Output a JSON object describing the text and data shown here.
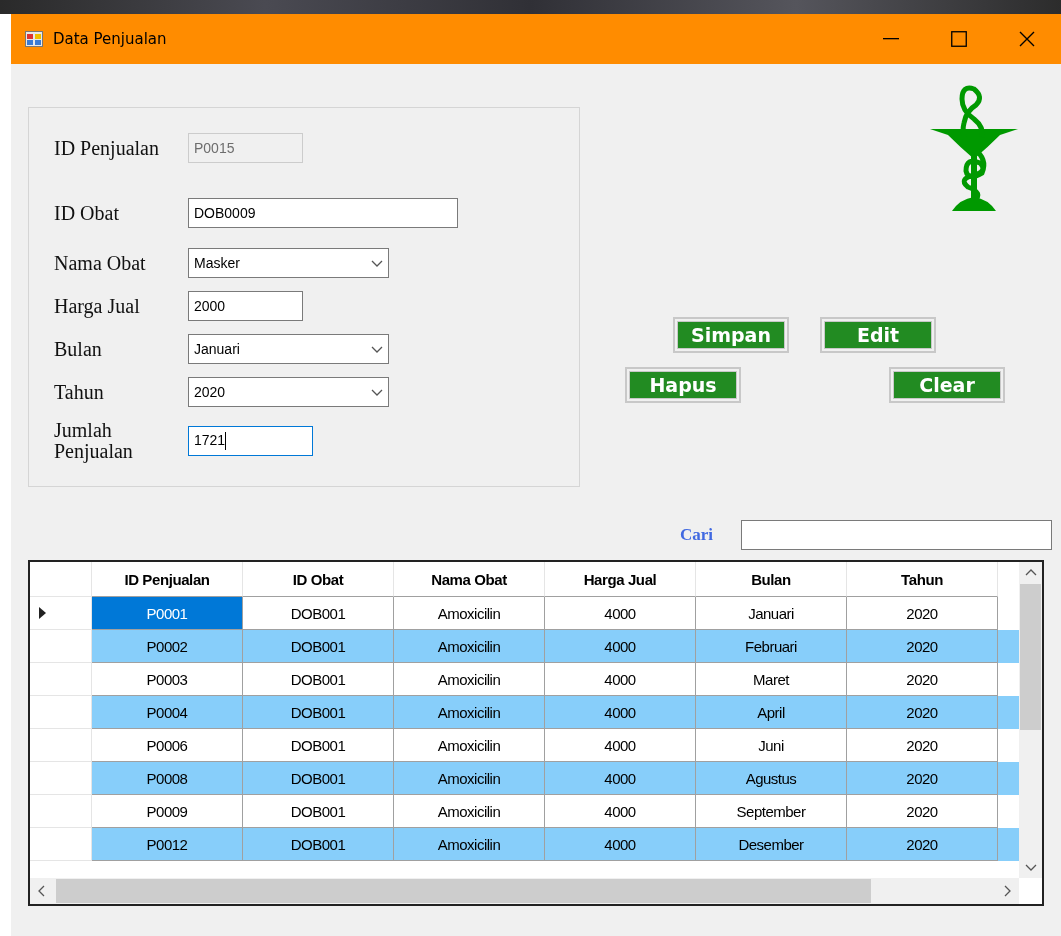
{
  "window": {
    "title": "Data Penjualan"
  },
  "form": {
    "fields": [
      {
        "label": "ID Penjualan",
        "kind": "text",
        "value": "P0015",
        "disabled": true,
        "focused": false
      },
      {
        "label": "ID Obat",
        "kind": "text",
        "value": "DOB0009",
        "disabled": false,
        "focused": false
      },
      {
        "label": "Nama Obat",
        "kind": "combo",
        "value": "Masker",
        "disabled": false,
        "focused": false
      },
      {
        "label": "Harga Jual",
        "kind": "text",
        "value": "2000",
        "disabled": false,
        "focused": false
      },
      {
        "label": "Bulan",
        "kind": "combo",
        "value": "Januari",
        "disabled": false,
        "focused": false
      },
      {
        "label": "Tahun",
        "kind": "combo",
        "value": "2020",
        "disabled": false,
        "focused": false
      },
      {
        "label": "Jumlah Penjualan",
        "kind": "text",
        "value": "1721",
        "disabled": false,
        "focused": true
      }
    ]
  },
  "buttons": [
    "Simpan",
    "Edit",
    "Hapus",
    "Clear"
  ],
  "search": {
    "label": "Cari"
  },
  "table": {
    "columns": [
      "ID Penjualan",
      "ID Obat",
      "Nama Obat",
      "Harga Jual",
      "Bulan",
      "Tahun"
    ],
    "rows": [
      {
        "current": true,
        "cells": [
          {
            "text": "P0001",
            "selected": true
          },
          {
            "text": "DOB001",
            "selected": false
          },
          {
            "text": "Amoxicilin",
            "selected": false
          },
          {
            "text": "4000",
            "selected": false
          },
          {
            "text": "Januari",
            "selected": false
          },
          {
            "text": "2020",
            "selected": false
          }
        ]
      },
      {
        "current": false,
        "cells": [
          {
            "text": "P0002",
            "selected": false
          },
          {
            "text": "DOB001",
            "selected": false
          },
          {
            "text": "Amoxicilin",
            "selected": false
          },
          {
            "text": "4000",
            "selected": false
          },
          {
            "text": "Februari",
            "selected": false
          },
          {
            "text": "2020",
            "selected": false
          }
        ]
      },
      {
        "current": false,
        "cells": [
          {
            "text": "P0003",
            "selected": false
          },
          {
            "text": "DOB001",
            "selected": false
          },
          {
            "text": "Amoxicilin",
            "selected": false
          },
          {
            "text": "4000",
            "selected": false
          },
          {
            "text": "Maret",
            "selected": false
          },
          {
            "text": "2020",
            "selected": false
          }
        ]
      },
      {
        "current": false,
        "cells": [
          {
            "text": "P0004",
            "selected": false
          },
          {
            "text": "DOB001",
            "selected": false
          },
          {
            "text": "Amoxicilin",
            "selected": false
          },
          {
            "text": "4000",
            "selected": false
          },
          {
            "text": "April",
            "selected": false
          },
          {
            "text": "2020",
            "selected": false
          }
        ]
      },
      {
        "current": false,
        "cells": [
          {
            "text": "P0006",
            "selected": false
          },
          {
            "text": "DOB001",
            "selected": false
          },
          {
            "text": "Amoxicilin",
            "selected": false
          },
          {
            "text": "4000",
            "selected": false
          },
          {
            "text": "Juni",
            "selected": false
          },
          {
            "text": "2020",
            "selected": false
          }
        ]
      },
      {
        "current": false,
        "cells": [
          {
            "text": "P0008",
            "selected": false
          },
          {
            "text": "DOB001",
            "selected": false
          },
          {
            "text": "Amoxicilin",
            "selected": false
          },
          {
            "text": "4000",
            "selected": false
          },
          {
            "text": "Agustus",
            "selected": false
          },
          {
            "text": "2020",
            "selected": false
          }
        ]
      },
      {
        "current": false,
        "cells": [
          {
            "text": "P0009",
            "selected": false
          },
          {
            "text": "DOB001",
            "selected": false
          },
          {
            "text": "Amoxicilin",
            "selected": false
          },
          {
            "text": "4000",
            "selected": false
          },
          {
            "text": "September",
            "selected": false
          },
          {
            "text": "2020",
            "selected": false
          }
        ]
      },
      {
        "current": false,
        "cells": [
          {
            "text": "P0012",
            "selected": false
          },
          {
            "text": "DOB001",
            "selected": false
          },
          {
            "text": "Amoxicilin",
            "selected": false
          },
          {
            "text": "4000",
            "selected": false
          },
          {
            "text": "Desember",
            "selected": false
          },
          {
            "text": "2020",
            "selected": false
          }
        ]
      }
    ]
  }
}
